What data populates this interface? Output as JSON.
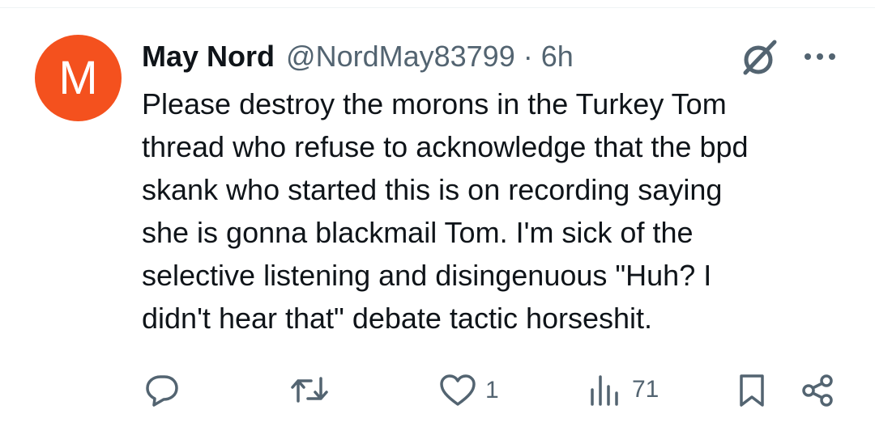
{
  "tweet": {
    "avatar_letter": "M",
    "avatar_color": "#f4511e",
    "display_name": "May Nord",
    "handle": "@NordMay83799",
    "separator": "·",
    "time": "6h",
    "text_lines": [
      "Please destroy the morons in the Turkey Tom",
      "thread who refuse to acknowledge that the bpd",
      "skank who started this is on recording saying",
      "she is gonna blackmail Tom. I'm sick of the",
      "selective listening and disingenuous \"Huh? I",
      "didn't hear that\" debate tactic horseshit."
    ]
  },
  "header_icons": [
    "grok-icon",
    "more-options-icon"
  ],
  "actions": {
    "reply": {
      "icon": "reply-icon",
      "count": ""
    },
    "repost": {
      "icon": "repost-icon",
      "count": ""
    },
    "like": {
      "icon": "heart-icon",
      "count": "1"
    },
    "views": {
      "icon": "views-icon",
      "count": "71"
    },
    "bookmark": {
      "icon": "bookmark-icon"
    },
    "share": {
      "icon": "share-icon"
    }
  },
  "colors": {
    "text": "#0f1419",
    "secondary": "#536471",
    "divider": "#eff3f4"
  }
}
